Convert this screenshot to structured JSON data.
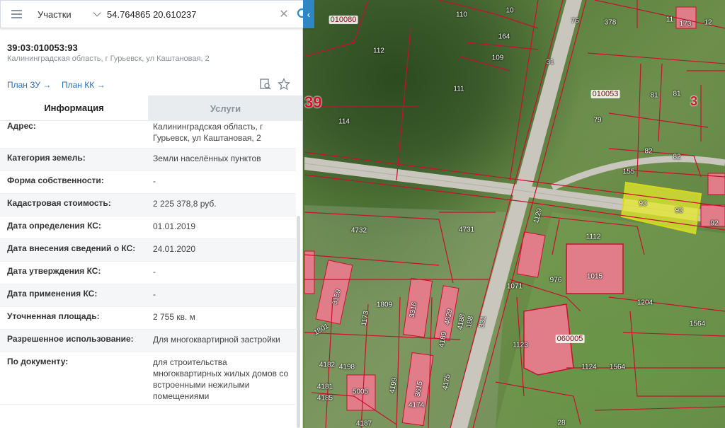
{
  "search": {
    "layer": "Участки",
    "query": "54.764865 20.610237"
  },
  "parcel": {
    "number": "39:03:010053:93",
    "address": "Калининградская область, г Гурьевск, ул Каштановая, 2",
    "links": {
      "plan_zu": "План ЗУ →",
      "plan_kk": "План КК →"
    }
  },
  "tabs": {
    "info": "Информация",
    "services": "Услуги"
  },
  "rows": [
    {
      "k": "Адрес:",
      "v": "Калининградская область, г Гурьевск, ул Каштановая, 2"
    },
    {
      "k": "Категория земель:",
      "v": "Земли населённых пунктов"
    },
    {
      "k": "Форма собственности:",
      "v": "-"
    },
    {
      "k": "Кадастровая стоимость:",
      "v": "2 225 378,8 руб."
    },
    {
      "k": "Дата определения КС:",
      "v": "01.01.2019"
    },
    {
      "k": "Дата внесения сведений о КС:",
      "v": "24.01.2020"
    },
    {
      "k": "Дата утверждения КС:",
      "v": "-"
    },
    {
      "k": "Дата применения КС:",
      "v": "-"
    },
    {
      "k": "Уточненная площадь:",
      "v": "2 755 кв. м"
    },
    {
      "k": "Разрешенное использование:",
      "v": "Для многоквартирной застройки"
    },
    {
      "k": "По документу:",
      "v": "для строительства многоквартирных жилых домов со встроенными нежилыми помещениями"
    }
  ],
  "map": {
    "quarters": [
      "010080",
      "010053",
      "060005"
    ],
    "region_labels": [
      "39",
      "3"
    ],
    "parcels": [
      "110",
      "10",
      "378",
      "11",
      "173",
      "12",
      "76",
      "164",
      "109",
      "112",
      "31",
      "111",
      "114",
      "81",
      "81",
      "79",
      "82",
      "82",
      "155",
      "93",
      "93",
      "92",
      "1129",
      "1112",
      "4732",
      "4731",
      "3159",
      "1809",
      "1173",
      "3316",
      "4629",
      "4188",
      "188",
      "331",
      "1071",
      "976",
      "1015",
      "1204",
      "1564",
      "1801",
      "4189",
      "1123",
      "060005",
      "1124",
      "1564",
      "4182",
      "4198",
      "5005",
      "4199",
      "3615",
      "4175",
      "4181",
      "4185",
      "4174",
      "4187",
      "28"
    ]
  },
  "colors": {
    "accent": "#2f86c4",
    "parcel_border": "#c8102e",
    "selected_fill": "#e6ea2c"
  }
}
